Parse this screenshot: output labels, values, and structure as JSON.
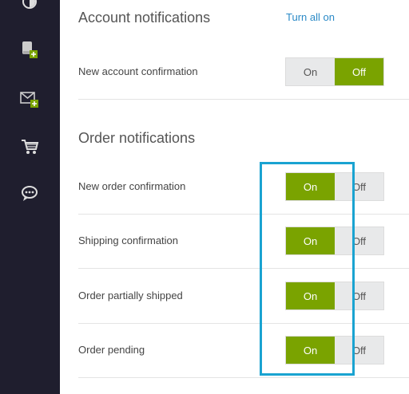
{
  "sidebar": {
    "icons": [
      "half-circle-icon",
      "device-add-icon",
      "mail-add-icon",
      "cart-icon",
      "chat-bubble-icon"
    ]
  },
  "account_section": {
    "title": "Account notifications",
    "turn_all_on": "Turn all on",
    "rows": [
      {
        "label": "New account confirmation",
        "on": "On",
        "off": "Off",
        "state": "off"
      }
    ]
  },
  "order_section": {
    "title": "Order notifications",
    "rows": [
      {
        "label": "New order confirmation",
        "on": "On",
        "off": "Off",
        "state": "on"
      },
      {
        "label": "Shipping confirmation",
        "on": "On",
        "off": "Off",
        "state": "on"
      },
      {
        "label": "Order partially shipped",
        "on": "On",
        "off": "Off",
        "state": "on"
      },
      {
        "label": "Order pending",
        "on": "On",
        "off": "Off",
        "state": "on"
      }
    ]
  },
  "colors": {
    "sidebar_bg": "#1f1e2e",
    "toggle_active": "#7aa300",
    "link": "#2b8ac7",
    "highlight": "#1aa3d1"
  }
}
